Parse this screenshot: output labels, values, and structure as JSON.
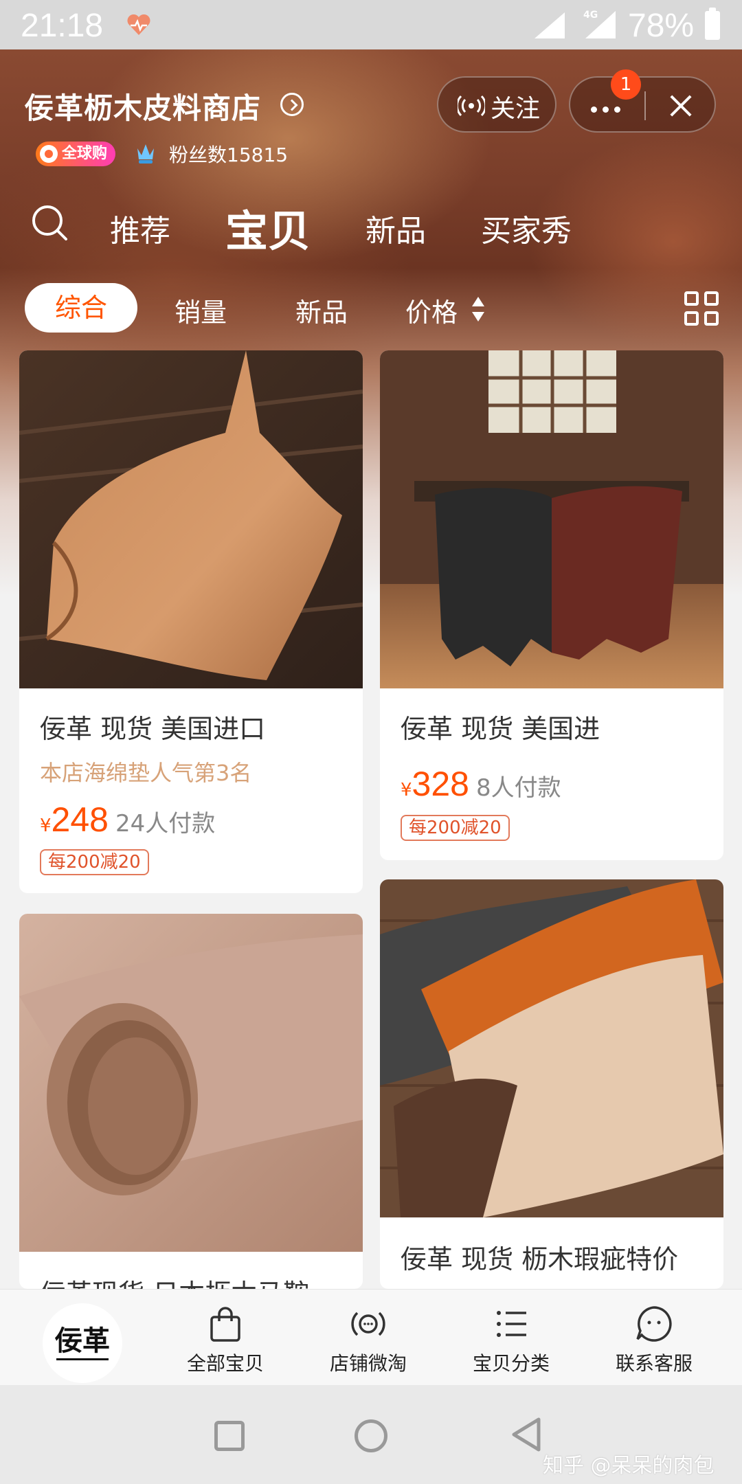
{
  "status_bar": {
    "time": "21:18",
    "network": "4G",
    "battery": "78%"
  },
  "shop": {
    "name": "佞革枥木皮料商店",
    "global_badge": "全球购",
    "fans": "粉丝数15815",
    "follow_label": "关注",
    "notification_count": "1"
  },
  "tabs": [
    {
      "label": "推荐",
      "active": false
    },
    {
      "label": "宝贝",
      "active": true
    },
    {
      "label": "新品",
      "active": false
    },
    {
      "label": "买家秀",
      "active": false
    }
  ],
  "sort": {
    "items": [
      "综合",
      "销量",
      "新品",
      "价格"
    ],
    "active": "综合"
  },
  "products": [
    {
      "title": "佞革 现货 美国进口",
      "rank": "本店海绵垫人气第3名",
      "yen": "¥",
      "price": "248",
      "paid": "24人付款",
      "promo": "每200减20"
    },
    {
      "title": "佞革 现货 美国进",
      "yen": "¥",
      "price": "328",
      "paid": "8人付款",
      "promo": "每200减20"
    },
    {
      "title": "佞革现货 日本枥木马鞍"
    },
    {
      "title": "佞革 现货 枥木瑕疵特价"
    }
  ],
  "bottom_nav": {
    "shop_logo_text": "佞革",
    "items": [
      "全部宝贝",
      "店铺微淘",
      "宝贝分类",
      "联系客服"
    ]
  },
  "watermark": "知乎 @呆呆的肉包",
  "colors": {
    "accent": "#ff5000",
    "promo_border": "#e2795a"
  }
}
